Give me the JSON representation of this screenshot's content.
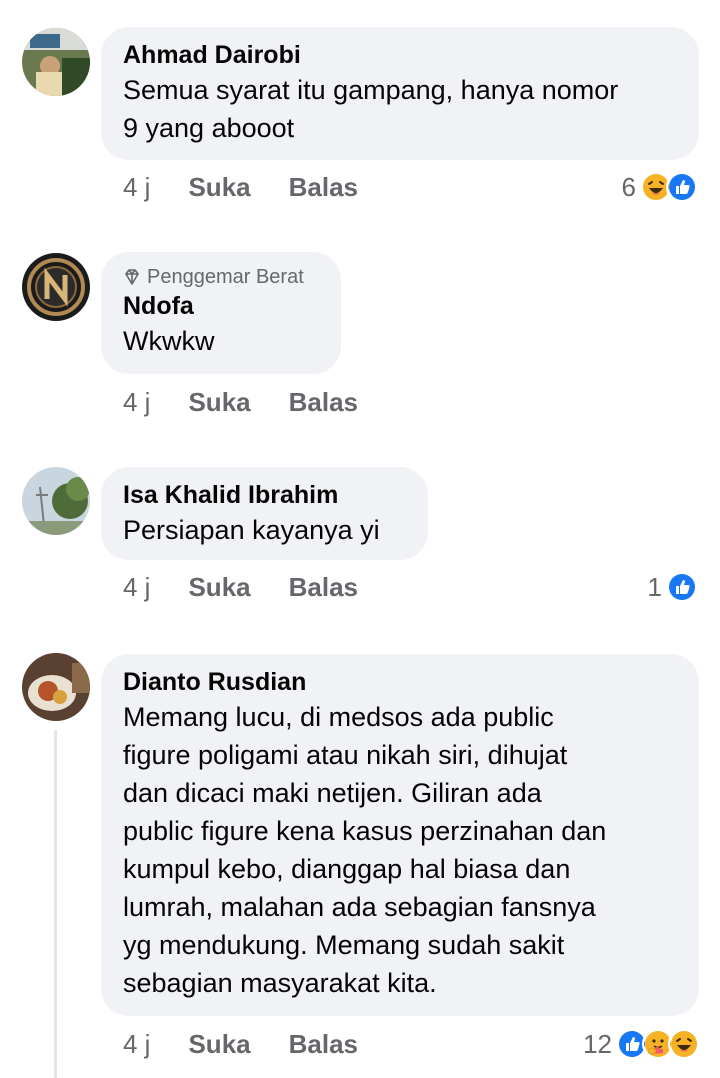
{
  "comments": [
    {
      "author": "Ahmad Dairobi",
      "text_lines": [
        "Semua syarat itu gampang, hanya nomor",
        "9 yang abooot"
      ],
      "time": "4 j",
      "like": "Suka",
      "reply": "Balas",
      "reaction_count": "6",
      "reactions": [
        "haha-icon",
        "like-icon"
      ]
    },
    {
      "badge": "Penggemar Berat",
      "author": "Ndofa",
      "text_lines": [
        "Wkwkw"
      ],
      "time": "4 j",
      "like": "Suka",
      "reply": "Balas"
    },
    {
      "author": "Isa Khalid Ibrahim",
      "text_lines": [
        "Persiapan kayanya yi"
      ],
      "time": "4 j",
      "like": "Suka",
      "reply": "Balas",
      "reaction_count": "1",
      "reactions": [
        "like-icon"
      ]
    },
    {
      "author": "Dianto Rusdian",
      "text_lines": [
        "Memang lucu, di medsos ada public",
        "figure poligami atau nikah siri, dihujat",
        "dan dicaci maki netijen. Giliran ada",
        "public figure kena kasus perzinahan dan",
        "kumpul kebo, dianggap hal biasa dan",
        "lumrah, malahan ada sebagian fansnya",
        "yg mendukung. Memang sudah sakit",
        "sebagian masyarakat kita."
      ],
      "time": "4 j",
      "like": "Suka",
      "reply": "Balas",
      "reaction_count": "12",
      "reactions": [
        "like-icon",
        "care-icon",
        "haha-icon"
      ]
    }
  ],
  "colors": {
    "bubble": "#f0f2f5",
    "secondary_text": "#65676b",
    "like_blue": "#1877f2",
    "haha_yellow": "#f7b125"
  }
}
